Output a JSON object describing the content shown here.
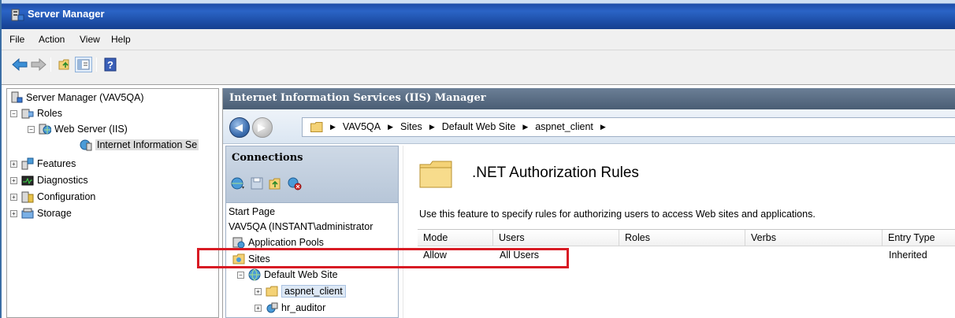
{
  "window": {
    "title": "Server Manager"
  },
  "menu": {
    "items": [
      "File",
      "Action",
      "View",
      "Help"
    ]
  },
  "tree": {
    "root": "Server Manager (VAV5QA)",
    "roles": "Roles",
    "web_server": "Web Server (IIS)",
    "iis_node": "Internet Information Se",
    "features": "Features",
    "diagnostics": "Diagnostics",
    "configuration": "Configuration",
    "storage": "Storage"
  },
  "iis": {
    "header": "Internet Information Services (IIS) Manager",
    "breadcrumbs": [
      "VAV5QA",
      "Sites",
      "Default Web Site",
      "aspnet_client"
    ]
  },
  "connections": {
    "title": "Connections",
    "items": {
      "start_page": "Start Page",
      "server": "VAV5QA (INSTANT\\administrator",
      "app_pools": "Application Pools",
      "sites": "Sites",
      "default_site": "Default Web Site",
      "aspnet_client": "aspnet_client",
      "hr_auditor": "hr_auditor"
    }
  },
  "feature": {
    "title": ".NET Authorization Rules",
    "description": "Use this feature to specify rules for authorizing users to access Web sites and applications.",
    "columns": [
      "Mode",
      "Users",
      "Roles",
      "Verbs",
      "Entry Type"
    ],
    "rows": [
      {
        "mode": "Allow",
        "users": "All Users",
        "roles": "",
        "verbs": "",
        "entry_type": "Inherited"
      }
    ]
  },
  "colors": {
    "titlebar": "#1e4ea8",
    "iis_header": "#5a6e86",
    "highlight": "#d81b24"
  }
}
